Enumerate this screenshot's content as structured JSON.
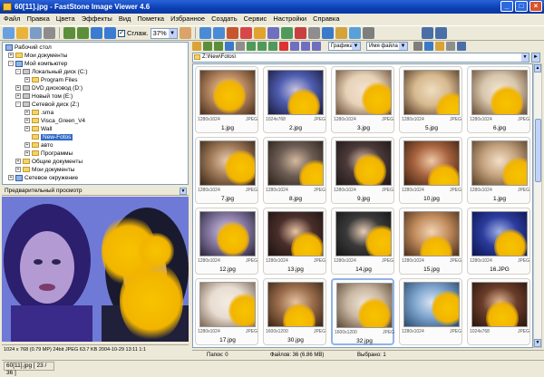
{
  "window": {
    "title": "60[11].jpg - FastStone Image Viewer 4.6"
  },
  "menu": [
    "Файл",
    "Правка",
    "Цвета",
    "Эффекты",
    "Вид",
    "Пометка",
    "Избранное",
    "Создать",
    "Сервис",
    "Настройки",
    "Справка"
  ],
  "toolbar": {
    "smooth_label": "Сглаж.",
    "zoom_value": "37%"
  },
  "toolbar2": {
    "filter_value": "Графика",
    "sort_value": "Имя файла"
  },
  "path": {
    "value": "Z:\\New\\Fotos\\"
  },
  "tree": {
    "desktop": "Рабочий стол",
    "my_docs": "Мои документы",
    "my_computer": "Мой компьютер",
    "local_disk": "Локальный диск (C:)",
    "program_files": "Program Files",
    "dvd": "DVD дисковод (D:)",
    "new_tom": "Новый том (E:)",
    "net_disk": "Сетевой диск (Z:)",
    "sub1": ".sma",
    "sub2": "Visca_Green_V4",
    "sub3": "Wall",
    "sub4": "New-Fotos",
    "sub5": "авто",
    "sub6": "Программы",
    "shared_docs": "Общие документы",
    "my_docs2": "Мои документы",
    "network": "Сетевое окружение"
  },
  "preview": {
    "header": "Предварительный просмотр",
    "info": "1024 x 768 (0.79 MP)  24bit  JPEG  63.7 KB  2004-10-29 13:11  1:1"
  },
  "thumbs": [
    {
      "name": "1.jpg",
      "dims": "1280x1024",
      "fmt": "JPEG"
    },
    {
      "name": "2.jpg",
      "dims": "1024x768",
      "fmt": "JPEG"
    },
    {
      "name": "3.jpg",
      "dims": "1280x1024",
      "fmt": "JPEG"
    },
    {
      "name": "5.jpg",
      "dims": "1280x1024",
      "fmt": "JPEG"
    },
    {
      "name": "6.jpg",
      "dims": "1280x1024",
      "fmt": "JPEG"
    },
    {
      "name": "7.jpg",
      "dims": "1280x1024",
      "fmt": "JPEG"
    },
    {
      "name": "8.jpg",
      "dims": "1280x1024",
      "fmt": "JPEG"
    },
    {
      "name": "9.jpg",
      "dims": "1280x1024",
      "fmt": "JPEG"
    },
    {
      "name": "10.jpg",
      "dims": "1280x1024",
      "fmt": "JPEG"
    },
    {
      "name": "1.jpg",
      "dims": "1280x1024",
      "fmt": "JPEG"
    },
    {
      "name": "12.jpg",
      "dims": "1280x1024",
      "fmt": "JPEG"
    },
    {
      "name": "13.jpg",
      "dims": "1280x1024",
      "fmt": "JPEG"
    },
    {
      "name": "14.jpg",
      "dims": "1280x1024",
      "fmt": "JPEG"
    },
    {
      "name": "15.jpg",
      "dims": "1280x1024",
      "fmt": "JPEG"
    },
    {
      "name": "16.JPG",
      "dims": "1280x1024",
      "fmt": "JPEG"
    },
    {
      "name": "17.jpg",
      "dims": "1280x1024",
      "fmt": "JPEG"
    },
    {
      "name": "30.jpg",
      "dims": "1600x1200",
      "fmt": "JPEG"
    },
    {
      "name": "32.jpg",
      "dims": "1600x1200",
      "fmt": "JPEG"
    },
    {
      "name": "",
      "dims": "1280x1024",
      "fmt": "JPEG"
    },
    {
      "name": "",
      "dims": "1024x768",
      "fmt": "JPEG"
    }
  ],
  "status": {
    "folders": "Папок: 0",
    "files": "Файлов: 36 (6.86 MB)",
    "selected": "Выбрано: 1"
  },
  "frame_status": {
    "file": "60[11].jpg [ 23 / 36 ]"
  },
  "colors": {
    "title_bar": "#0a3fb5",
    "selection": "#316ac5",
    "blot": "#f2b400",
    "preview_bg": "#6f7ad6"
  }
}
